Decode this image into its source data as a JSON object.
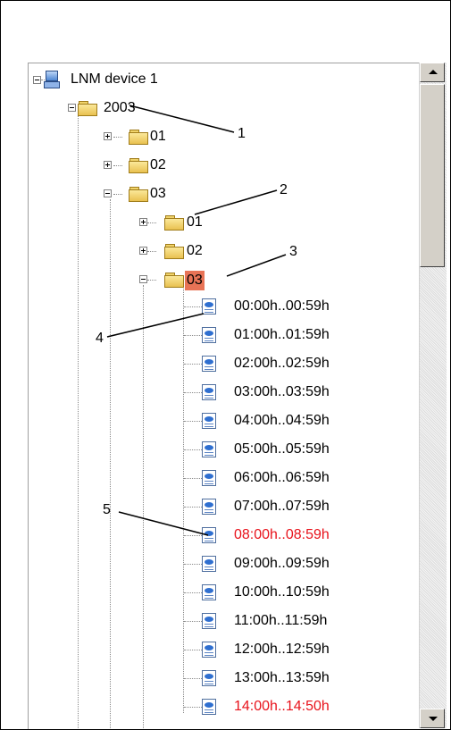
{
  "tree": {
    "root": {
      "label": "LNM device 1"
    },
    "year": {
      "label": "2003"
    },
    "months": [
      {
        "label": "01"
      },
      {
        "label": "02"
      },
      {
        "label": "03"
      }
    ],
    "days": [
      {
        "label": "01"
      },
      {
        "label": "02"
      },
      {
        "label": "03"
      }
    ],
    "hours": [
      {
        "label": "00:00h..00:59h",
        "highlight": false
      },
      {
        "label": "01:00h..01:59h",
        "highlight": false
      },
      {
        "label": "02:00h..02:59h",
        "highlight": false
      },
      {
        "label": "03:00h..03:59h",
        "highlight": false
      },
      {
        "label": "04:00h..04:59h",
        "highlight": false
      },
      {
        "label": "05:00h..05:59h",
        "highlight": false
      },
      {
        "label": "06:00h..06:59h",
        "highlight": false
      },
      {
        "label": "07:00h..07:59h",
        "highlight": false
      },
      {
        "label": "08:00h..08:59h",
        "highlight": true
      },
      {
        "label": "09:00h..09:59h",
        "highlight": false
      },
      {
        "label": "10:00h..10:59h",
        "highlight": false
      },
      {
        "label": "11:00h..11:59h",
        "highlight": false
      },
      {
        "label": "12:00h..12:59h",
        "highlight": false
      },
      {
        "label": "13:00h..13:59h",
        "highlight": false
      },
      {
        "label": "14:00h..14:50h",
        "highlight": true
      }
    ]
  },
  "annotations": [
    "1",
    "2",
    "3",
    "4",
    "5"
  ],
  "colors": {
    "highlight_text": "#e8121b",
    "selection": "#e87356"
  }
}
